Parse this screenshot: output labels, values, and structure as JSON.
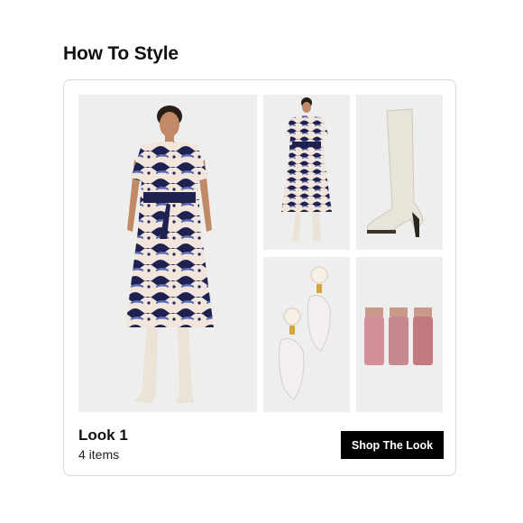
{
  "section": {
    "title": "How To Style"
  },
  "look": {
    "title": "Look 1",
    "count": "4 items",
    "shop_label": "Shop The Look"
  },
  "images": {
    "main": "model-in-printed-dress-and-white-boots",
    "dress": "printed-midi-dress",
    "boot": "white-knee-high-boot",
    "earring": "pearl-drop-earrings",
    "lip": "pink-lip-tints"
  },
  "colors": {
    "button_bg": "#000000",
    "button_text": "#ffffff",
    "card_border": "#d9d9d9",
    "tile_bg": "#efefef",
    "dress_navy": "#1f2250",
    "dress_blue": "#5b6bb0",
    "dress_cream": "#f2e6dc"
  }
}
